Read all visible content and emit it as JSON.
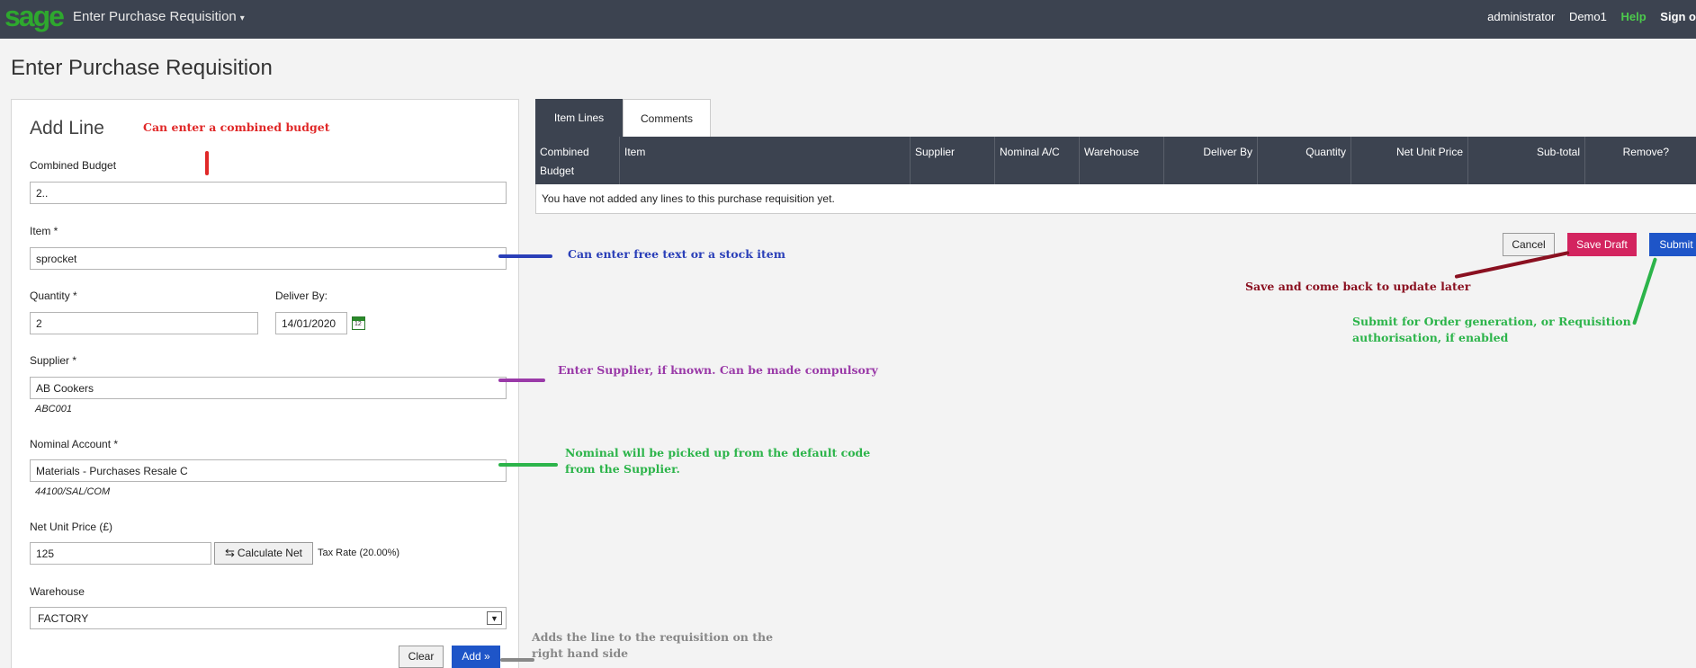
{
  "topbar": {
    "logo": "sage",
    "app_title": "Enter Purchase Requisition",
    "user": "administrator",
    "company": "Demo1",
    "help": "Help",
    "signout": "Sign o"
  },
  "page": {
    "title": "Enter Purchase Requisition"
  },
  "add_line": {
    "title": "Add Line",
    "combined_budget": {
      "label": "Combined Budget",
      "value": "2.."
    },
    "item": {
      "label": "Item *",
      "value": "sprocket"
    },
    "quantity": {
      "label": "Quantity *",
      "value": "2"
    },
    "deliver_by": {
      "label": "Deliver By:",
      "value": "14/01/2020"
    },
    "supplier": {
      "label": "Supplier *",
      "value": "AB Cookers",
      "code": "ABC001"
    },
    "nominal": {
      "label": "Nominal Account *",
      "value": "Materials - Purchases Resale C",
      "code": "44100/SAL/COM"
    },
    "net_unit_price": {
      "label": "Net Unit Price (£)",
      "value": "125"
    },
    "calculate_net": "Calculate Net",
    "tax_rate": "Tax Rate (20.00%)",
    "warehouse": {
      "label": "Warehouse",
      "value": "FACTORY"
    },
    "clear": "Clear",
    "add": "Add »"
  },
  "tabs": [
    "Item Lines",
    "Comments"
  ],
  "grid": {
    "headers": [
      "Combined Budget",
      "Item",
      "Supplier",
      "Nominal A/C",
      "Warehouse",
      "Deliver By",
      "Quantity",
      "Net Unit Price",
      "Sub-total",
      "Remove?"
    ],
    "empty_message": "You have not added any lines to this purchase requisition yet."
  },
  "actions": {
    "cancel": "Cancel",
    "save_draft": "Save Draft",
    "submit": "Submit"
  },
  "annotations": {
    "combined_budget": "Can enter a combined budget",
    "item": "Can enter free text or a stock item",
    "supplier": "Enter Supplier, if known. Can be made compulsory",
    "nominal_1": "Nominal will be picked up from the default code",
    "nominal_2": "from the Supplier.",
    "save_draft": "Save and come back to update later",
    "submit_1": "Submit for Order generation, or Requisition",
    "submit_2": "authorisation, if enabled",
    "add_1": "Adds the line to the requisition on the",
    "add_2": "right hand side"
  },
  "colors": {
    "topbar": "#3c4350",
    "brand_green": "#2ea82e",
    "primary_blue": "#1e55c8",
    "save_pink": "#d3245f"
  }
}
